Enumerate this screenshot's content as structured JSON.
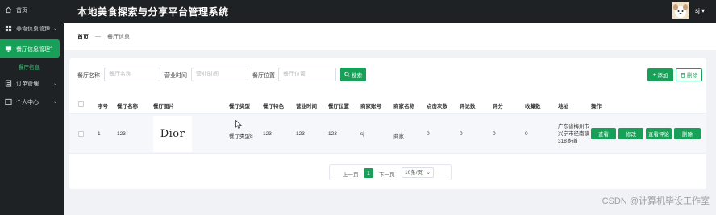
{
  "header": {
    "title": "本地美食探索与分享平台管理系统",
    "user": "sj",
    "user_caret": "▾"
  },
  "sidebar": {
    "items": [
      {
        "label": "首页",
        "icon": "home-icon"
      },
      {
        "label": "美食信息管理",
        "icon": "grid-icon",
        "expand": "⌄"
      },
      {
        "label": "餐厅信息管理",
        "icon": "monitor-icon",
        "expand": "⌃",
        "active": true
      },
      {
        "label": "订单管理",
        "icon": "order-icon",
        "expand": "⌄"
      },
      {
        "label": "个人中心",
        "icon": "person-icon",
        "expand": "⌄"
      }
    ],
    "submenu": "餐厅信息"
  },
  "breadcrumb": {
    "home": "首页",
    "separator": "—",
    "current": "餐厅信息"
  },
  "search": {
    "name_label": "餐厅名称",
    "name_placeholder": "餐厅名称",
    "time_label": "营业时间",
    "time_placeholder": "营业时间",
    "location_label": "餐厅位置",
    "location_placeholder": "餐厅位置",
    "search_button": "搜索",
    "add_button": "添加",
    "delete_button": "删除"
  },
  "table": {
    "headers": [
      "序号",
      "餐厅名称",
      "餐厅图片",
      "餐厅类型",
      "餐厅特色",
      "营业时间",
      "餐厅位置",
      "商家账号",
      "商家名称",
      "点击次数",
      "评论数",
      "评分",
      "收藏数",
      "地址",
      "操作"
    ],
    "rows": [
      {
        "index": "1",
        "name": "123",
        "image_text": "Dior",
        "type": "餐厅类型8",
        "feature": "123",
        "hours": "123",
        "location": "123",
        "merchant_account": "sj",
        "merchant_name": "商家",
        "clicks": "0",
        "comments": "0",
        "rating": "0",
        "favorites": "0",
        "address": "广东省梅州市兴宁市径南镇318乡道",
        "actions": {
          "view": "查看",
          "edit": "修改",
          "view_comments": "查看评论",
          "delete": "删除"
        }
      }
    ]
  },
  "pagination": {
    "prev": "上一页",
    "current": "1",
    "next": "下一页",
    "page_size": "10条/页",
    "size_caret": "⌄"
  },
  "watermark": "CSDN @计算机毕设工作室",
  "colors": {
    "accent": "#18a058",
    "sidebar_bg": "#1f2224"
  }
}
